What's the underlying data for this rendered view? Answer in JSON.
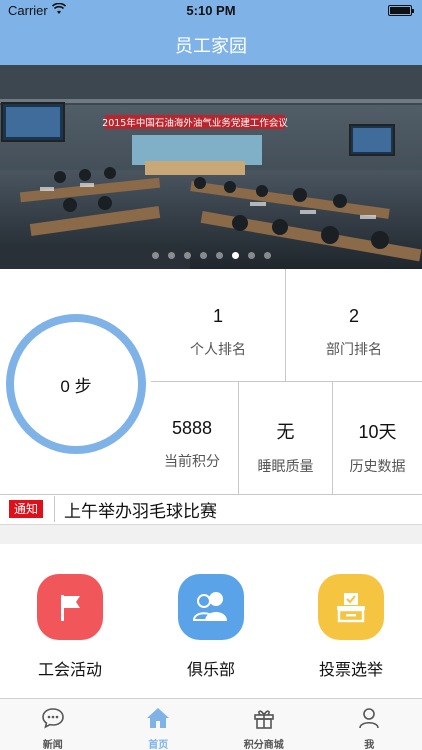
{
  "status_bar": {
    "carrier": "Carrier",
    "time": "5:10 PM"
  },
  "nav": {
    "title": "员工家园"
  },
  "banner": {
    "slogan": "2015年中国石油海外油气业务党建工作会议",
    "page_count": 8,
    "active_index": 5
  },
  "steps": {
    "value": "0 步"
  },
  "stats": {
    "personal_rank": {
      "value": "1",
      "label": "个人排名"
    },
    "dept_rank": {
      "value": "2",
      "label": "部门排名"
    },
    "points": {
      "value": "5888",
      "label": "当前积分"
    },
    "sleep": {
      "value": "无",
      "label": "睡眠质量"
    },
    "history": {
      "value": "10天",
      "label": "历史数据"
    }
  },
  "notice": {
    "badge": "通知",
    "text": "上午举办羽毛球比赛"
  },
  "features": [
    {
      "label": "工会活动",
      "icon": "flag-icon",
      "color": "#f0565a"
    },
    {
      "label": "俱乐部",
      "icon": "people-icon",
      "color": "#5aa3e8"
    },
    {
      "label": "投票选举",
      "icon": "ballot-box-icon",
      "color": "#f5c542"
    }
  ],
  "tabs": [
    {
      "label": "新闻",
      "icon": "chat-bubble-icon",
      "active": false
    },
    {
      "label": "首页",
      "icon": "home-icon",
      "active": true
    },
    {
      "label": "积分商城",
      "icon": "gift-icon",
      "active": false
    },
    {
      "label": "我",
      "icon": "person-icon",
      "active": false
    }
  ],
  "colors": {
    "primary": "#7fb3e8",
    "notice_badge": "#e0101a"
  }
}
